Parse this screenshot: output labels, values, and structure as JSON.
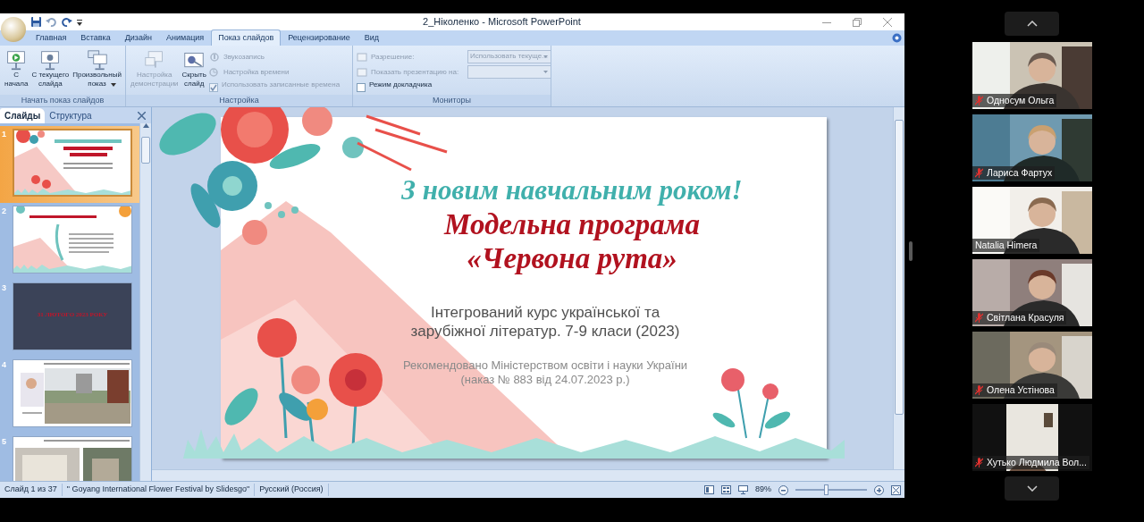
{
  "window": {
    "title": "2_Ніколенко - Microsoft PowerPoint"
  },
  "ribbon": {
    "tabs": [
      {
        "label": "Главная",
        "selected": false
      },
      {
        "label": "Вставка",
        "selected": false
      },
      {
        "label": "Дизайн",
        "selected": false
      },
      {
        "label": "Анимация",
        "selected": false
      },
      {
        "label": "Показ слайдов",
        "selected": true
      },
      {
        "label": "Рецензирование",
        "selected": false
      },
      {
        "label": "Вид",
        "selected": false
      }
    ],
    "groups": [
      {
        "label": "Начать показ слайдов",
        "controls": [
          {
            "kind": "large",
            "label": "С\nначала",
            "disabled": false
          },
          {
            "kind": "large",
            "label": "С текущего\nслайда",
            "disabled": false
          },
          {
            "kind": "large",
            "label": "Произвольный\nпоказ",
            "disabled": false,
            "dropdown": true
          }
        ]
      },
      {
        "label": "Настройка",
        "controls": [
          {
            "kind": "large",
            "label": "Настройка\nдемонстрации",
            "disabled": true
          },
          {
            "kind": "large",
            "label": "Скрыть\nслайд",
            "disabled": false
          },
          {
            "kind": "stack",
            "items": [
              {
                "kind": "small",
                "label": "Звукозапись",
                "disabled": true
              },
              {
                "kind": "small",
                "label": "Настройка времени",
                "disabled": true
              },
              {
                "kind": "check",
                "label": "Использовать записанные времена",
                "checked": true,
                "disabled": true
              }
            ]
          }
        ]
      },
      {
        "label": "Мониторы",
        "controls": [
          {
            "kind": "stack",
            "items": [
              {
                "kind": "combo",
                "label": "Разрешение:",
                "value": "Использовать текуще...",
                "disabled": true
              },
              {
                "kind": "combo",
                "label": "Показать презентацию на:",
                "disabled": true
              },
              {
                "kind": "check",
                "label": "Режим докладчика",
                "checked": false,
                "disabled": false
              }
            ]
          }
        ]
      }
    ]
  },
  "slides_pane": {
    "tabs": [
      {
        "label": "Слайды",
        "selected": true
      },
      {
        "label": "Структура",
        "selected": false
      }
    ],
    "thumbnails": [
      {
        "number": "1",
        "kind": "title",
        "selected": true
      },
      {
        "number": "2",
        "kind": "list",
        "selected": false
      },
      {
        "number": "3",
        "kind": "dark",
        "text": "31 ЛЮТОГО 2023 РОКУ",
        "selected": false
      },
      {
        "number": "4",
        "selected": false
      },
      {
        "number": "5",
        "kind": "photos",
        "selected": false
      }
    ]
  },
  "slide": {
    "heading": "З новим навчальним роком!",
    "title": "Модельна програма\n«Червона рута»",
    "subtitle": "Інтегрований курс української та\nзарубіжної літератур. 7-9 класи (2023)",
    "note": "Рекомендовано Міністерством освіти і науки України\n(наказ № 883 від 24.07.2023 р.)"
  },
  "status_bar": {
    "items": [
      "Слайд 1 из 37",
      "\" Goyang International Flower Festival by Slidesgo\"",
      "Русский (Россия)"
    ],
    "zoom": "89%",
    "zoom_level": {
      "level": 0.44
    }
  },
  "participants": [
    {
      "name": "Односум Ольга",
      "muted": true
    },
    {
      "name": "Лариса Фартух",
      "muted": true
    },
    {
      "name": "Natalia Himera",
      "muted": false
    },
    {
      "name": "Світлана Красуля",
      "muted": true
    },
    {
      "name": "Олена Устінова",
      "muted": true
    },
    {
      "name": "Хутько Людмила Вол...",
      "muted": true
    }
  ]
}
